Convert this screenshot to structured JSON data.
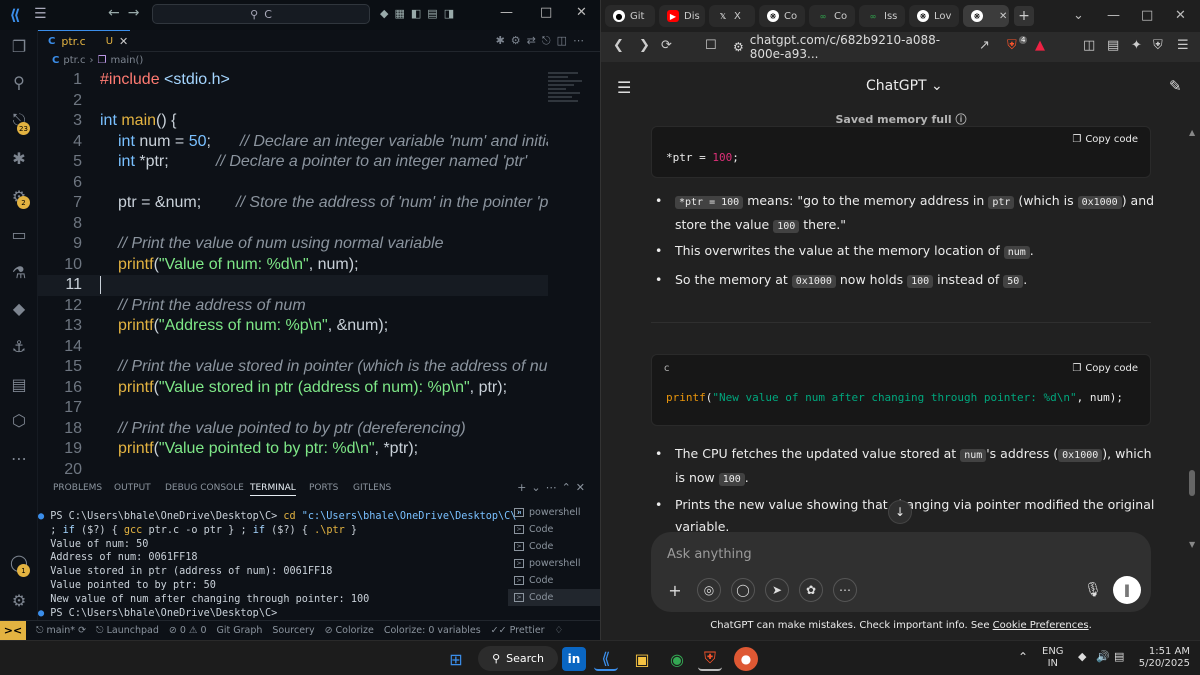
{
  "vscode": {
    "search": "C",
    "tab": {
      "lang": "C",
      "name": "ptr.c",
      "status": "U"
    },
    "breadcrumb": {
      "file": "ptr.c",
      "symbol": "main()"
    },
    "badges": {
      "source_control": "23",
      "extensions": "2",
      "accounts": "1"
    },
    "code_lines": [
      {
        "n": "1"
      },
      {
        "n": "2"
      },
      {
        "n": "3"
      },
      {
        "n": "4"
      },
      {
        "n": "5"
      },
      {
        "n": "6"
      },
      {
        "n": "7"
      },
      {
        "n": "8"
      },
      {
        "n": "9"
      },
      {
        "n": "10"
      },
      {
        "n": "11"
      },
      {
        "n": "12"
      },
      {
        "n": "13"
      },
      {
        "n": "14"
      },
      {
        "n": "15"
      },
      {
        "n": "16"
      },
      {
        "n": "17"
      },
      {
        "n": "18"
      },
      {
        "n": "19"
      },
      {
        "n": "20"
      }
    ],
    "code": {
      "l1_a": "#include ",
      "l1_b": "<stdio.h>",
      "l3_a": "int ",
      "l3_b": "main",
      "l3_c": "() {",
      "l4_a": "int ",
      "l4_b": "num = ",
      "l4_c": "50",
      "l4_d": ";",
      "l4_e": "// Declare an integer variable 'num' and initial",
      "l5_a": "int ",
      "l5_b": "*ptr;",
      "l5_c": "// Declare a pointer to an integer named 'ptr'",
      "l7_a": "ptr = &num;",
      "l7_b": "// Store the address of 'num' in the pointer 'ptr",
      "l9": "// Print the value of num using normal variable",
      "l10_a": "printf",
      "l10_b": "(",
      "l10_c": "\"Value of num: %d\\n\"",
      "l10_d": ", num);",
      "l12": "// Print the address of num",
      "l13_a": "printf",
      "l13_b": "(",
      "l13_c": "\"Address of num: %p\\n\"",
      "l13_d": ", &num);",
      "l15": "// Print the value stored in pointer (which is the address of num)",
      "l16_a": "printf",
      "l16_b": "(",
      "l16_c": "\"Value stored in ptr (address of num): %p\\n\"",
      "l16_d": ", ptr);",
      "l18": "// Print the value pointed to by ptr (dereferencing)",
      "l19_a": "printf",
      "l19_b": "(",
      "l19_c": "\"Value pointed to by ptr: %d\\n\"",
      "l19_d": ", *ptr);"
    },
    "panel_tabs": [
      "PROBLEMS",
      "OUTPUT",
      "DEBUG CONSOLE",
      "TERMINAL",
      "PORTS",
      "GITLENS"
    ],
    "terminal": {
      "l1_a": "PS C:\\Users\\bhale\\OneDrive\\Desktop\\C> ",
      "l1_b": "cd ",
      "l1_c": "\"c:\\Users\\bhale\\OneDrive\\Desktop\\C\\\"",
      "l2_a": "; ",
      "l2_b": "if ",
      "l2_c": "($?) { ",
      "l2_d": "gcc ",
      "l2_e": "ptr.c -o ptr } ; ",
      "l2_f": "if ",
      "l2_g": "($?) { ",
      "l2_h": ".\\ptr ",
      "l2_i": "}",
      "out": [
        "Value of num: 50",
        "Address of num: 0061FF18",
        "Value stored in ptr (address of num): 0061FF18",
        "Value pointed to by ptr: 50",
        "New value of num after changing through pointer: 100",
        "PS C:\\Users\\bhale\\OneDrive\\Desktop\\C>"
      ]
    },
    "terminal_list": [
      "powershell",
      "Code",
      "Code",
      "powershell",
      "Code",
      "Code"
    ],
    "status": {
      "branch": "main*",
      "launchpad": "Launchpad",
      "errors": "0",
      "warnings": "0",
      "git_graph": "Git Graph",
      "sourcery": "Sourcery",
      "colorize": "Colorize",
      "colorize_vars": "Colorize: 0 variables",
      "prettier": "Prettier"
    }
  },
  "browser": {
    "tabs": [
      {
        "label": "Git",
        "icon": "github-icon",
        "color": "#ffffff"
      },
      {
        "label": "Dis",
        "icon": "youtube-icon",
        "color": "#ff0000"
      },
      {
        "label": "X",
        "icon": "x-icon",
        "color": "#ffffff"
      },
      {
        "label": "Co",
        "icon": "chatgpt-icon",
        "color": "#ffffff"
      },
      {
        "label": "Co",
        "icon": "gfg-icon",
        "color": "#2f8d46"
      },
      {
        "label": "Iss",
        "icon": "gfg-icon",
        "color": "#2f8d46"
      },
      {
        "label": "Lov",
        "icon": "chatgpt-icon",
        "color": "#ffffff"
      },
      {
        "label": "",
        "icon": "chatgpt-icon",
        "color": "#ffffff"
      }
    ],
    "url": "chatgpt.com/c/682b9210-a088-800e-a93...",
    "shield_count": "4",
    "chatgpt": {
      "title": "ChatGPT",
      "memory": "Saved memory full",
      "block1": {
        "copy": "Copy code",
        "code_a": "*ptr = ",
        "code_b": "100",
        "code_c": ";"
      },
      "b1": {
        "a": "*ptr = 100",
        "b": " means: \"go to the memory address in ",
        "c": "ptr",
        "d": " (which is ",
        "e": "0x1000",
        "f": ") and store the value ",
        "g": "100",
        "h": " there.\""
      },
      "b2": {
        "a": "This overwrites the value at the memory location of ",
        "b": "num",
        "c": "."
      },
      "b3": {
        "a": "So the memory at ",
        "b": "0x1000",
        "c": " now holds ",
        "d": "100",
        "e": " instead of ",
        "f": "50",
        "g": "."
      },
      "block2": {
        "lang": "c",
        "copy": "Copy code",
        "fn": "printf",
        "p1": "(",
        "str": "\"New value of num after changing through pointer: %d\\n\"",
        "p2": ", num);"
      },
      "b4": {
        "a": "The CPU fetches the updated value stored at ",
        "b": "num",
        "c": "'s address (",
        "d": "0x1000",
        "e": "), which is now ",
        "f": "100",
        "g": "."
      },
      "b5": "Prints the new value showing that changing via pointer modified the original variable.",
      "placeholder": "Ask anything",
      "disclaimer_a": "ChatGPT can make mistakes. Check important info. See ",
      "disclaimer_link": "Cookie Preferences",
      "disclaimer_b": "."
    }
  },
  "taskbar": {
    "search": "Search",
    "lang_a": "ENG",
    "lang_b": "IN",
    "time": "1:51 AM",
    "date": "5/20/2025"
  }
}
